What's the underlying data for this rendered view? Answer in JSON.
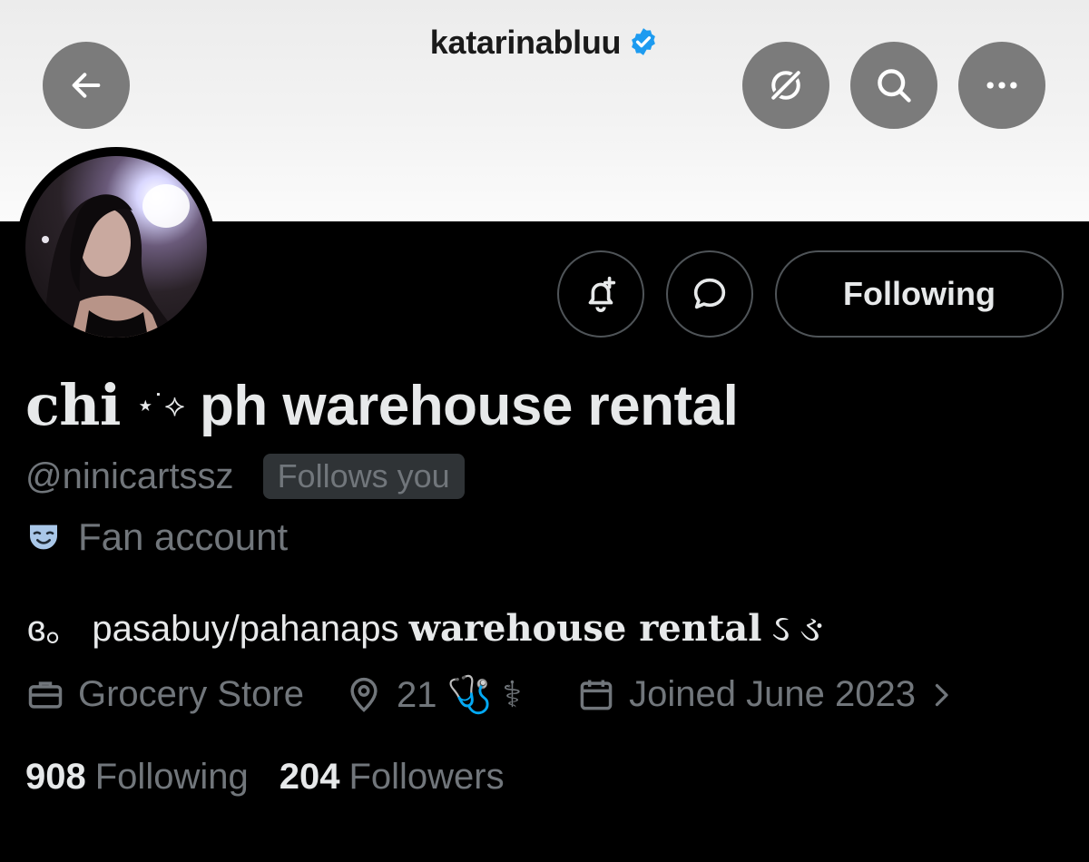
{
  "header": {
    "title": "katarinabluu",
    "verified_color": "#1d9bf0",
    "back_icon": "arrow-left-icon",
    "grok_icon": "grok-icon",
    "search_icon": "search-icon",
    "more_icon": "more-horizontal-icon"
  },
  "actions": {
    "notify_icon": "bell-plus-icon",
    "message_icon": "message-bubble-icon",
    "following_label": "Following"
  },
  "profile": {
    "name_prefix": "chi",
    "name_decor": "⋆˙⟡",
    "name_suffix": "ph warehouse rental",
    "handle": "@ninicartssz",
    "follows_badge": "Follows you",
    "category": "Fan account",
    "bio_start": "ɞ。 pasabuy/pahanaps ",
    "bio_bold": "warehouse rental",
    "bio_end": " ઽ ઙ",
    "business_type": "Grocery Store",
    "location": "21 🩺 ⚕",
    "joined": "Joined June 2023"
  },
  "stats": {
    "following_count": "908",
    "following_label": "Following",
    "followers_count": "204",
    "followers_label": "Followers"
  },
  "colors": {
    "background": "#000000",
    "banner": "#f0f0f0",
    "header_button": "#7b7b7b",
    "text_primary": "#e7e9ea",
    "text_secondary": "#71767b",
    "border": "#4f5458",
    "badge_bg": "#2f3336",
    "category_icon": "#a9c7e8"
  }
}
